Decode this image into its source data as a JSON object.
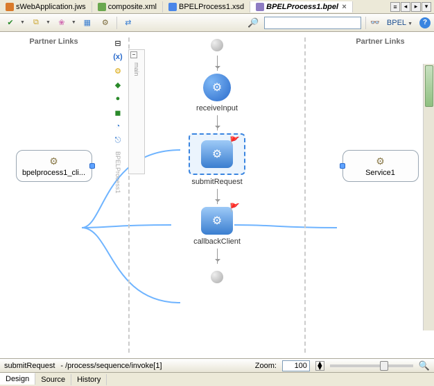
{
  "tabs": [
    {
      "label": "sWebApplication.jws",
      "icon": "ic-java",
      "active": false
    },
    {
      "label": "composite.xml",
      "icon": "ic-xml",
      "active": false
    },
    {
      "label": "BPELProcess1.xsd",
      "icon": "ic-xsd",
      "active": false
    },
    {
      "label": "BPELProcess1.bpel",
      "icon": "ic-bpel",
      "active": true
    }
  ],
  "toolbar": {
    "right_label": "BPEL",
    "search_placeholder": ""
  },
  "left": {
    "title": "Partner Links",
    "box_label": "bpelprocess1_cli..."
  },
  "right": {
    "title": "Partner Links",
    "box_label": "Service1"
  },
  "palette": {
    "collapse": "⊟",
    "variables": "(x)",
    "main_label": "main",
    "bpel_label": "BPELProcess1"
  },
  "flow": {
    "n1": "receiveInput",
    "n2": "submitRequest",
    "n3": "callbackClient"
  },
  "status": {
    "selection": "submitRequest",
    "path": " - /process/sequence/invoke[1]",
    "zoom_label": "Zoom:",
    "zoom_value": "100"
  },
  "bottom_tabs": [
    "Design",
    "Source",
    "History"
  ],
  "active_bottom_tab": "Design"
}
